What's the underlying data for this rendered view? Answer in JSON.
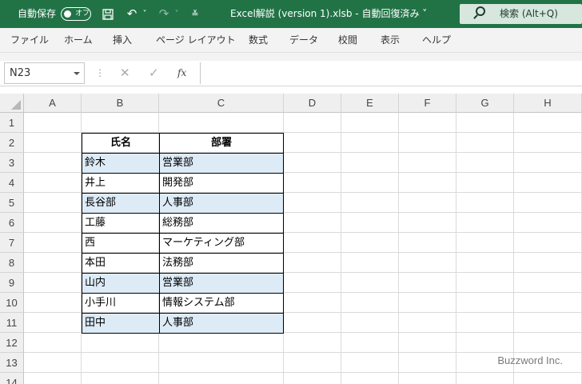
{
  "titlebar": {
    "autosave_label": "自動保存",
    "toggle_label": "オフ",
    "filename": "Excel解説 (version 1).xlsb  -  自動回復済み ˅",
    "search_label": "検索 (Alt+Q)"
  },
  "ribbon": {
    "tabs": [
      "ファイル",
      "ホーム",
      "挿入",
      "ページ レイアウト",
      "数式",
      "データ",
      "校閲",
      "表示",
      "ヘルプ"
    ]
  },
  "formula_bar": {
    "name_box": "N23",
    "fx_label": "fx"
  },
  "sheet": {
    "columns": [
      "A",
      "B",
      "C",
      "D",
      "E",
      "F",
      "G",
      "H"
    ],
    "rows": [
      "1",
      "2",
      "3",
      "4",
      "5",
      "6",
      "7",
      "8",
      "9",
      "10",
      "11",
      "12",
      "13",
      "14"
    ],
    "table_header": [
      "氏名",
      "部署"
    ],
    "table_rows": [
      [
        "鈴木",
        "営業部"
      ],
      [
        "井上",
        "開発部"
      ],
      [
        "長谷部",
        "人事部"
      ],
      [
        "工藤",
        "総務部"
      ],
      [
        "西",
        "マーケティング部"
      ],
      [
        "本田",
        "法務部"
      ],
      [
        "山内",
        "営業部"
      ],
      [
        "小手川",
        "情報システム部"
      ],
      [
        "田中",
        "人事部"
      ]
    ],
    "highlight_color": "#ddebf7"
  },
  "watermark": "Buzzword Inc."
}
